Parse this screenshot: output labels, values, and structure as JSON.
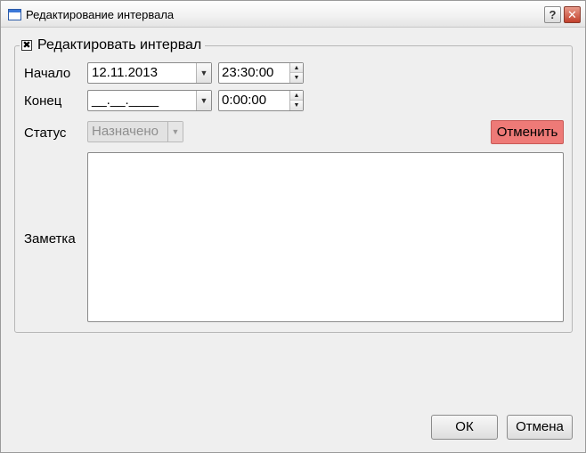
{
  "window": {
    "title": "Редактирование интервала"
  },
  "titlebar_buttons": {
    "help": "?",
    "close": "✕"
  },
  "group": {
    "label": "Редактировать интервал",
    "checked": true,
    "check_mark": "✖"
  },
  "start": {
    "label": "Начало",
    "date": "12.11.2013",
    "time": "23:30:00"
  },
  "end": {
    "label": "Конец",
    "date": "__.__.____",
    "time": "0:00:00"
  },
  "status": {
    "label": "Статус",
    "value": "Назначено",
    "enabled": false,
    "cancel_button": "Отменить",
    "cancel_color": "#ee7a77"
  },
  "note": {
    "label": "Заметка",
    "value": ""
  },
  "buttons": {
    "ok": "ОК",
    "cancel": "Отмена"
  },
  "icons": {
    "dropdown_arrow": "▼",
    "spin_up": "▲",
    "spin_down": "▼"
  }
}
